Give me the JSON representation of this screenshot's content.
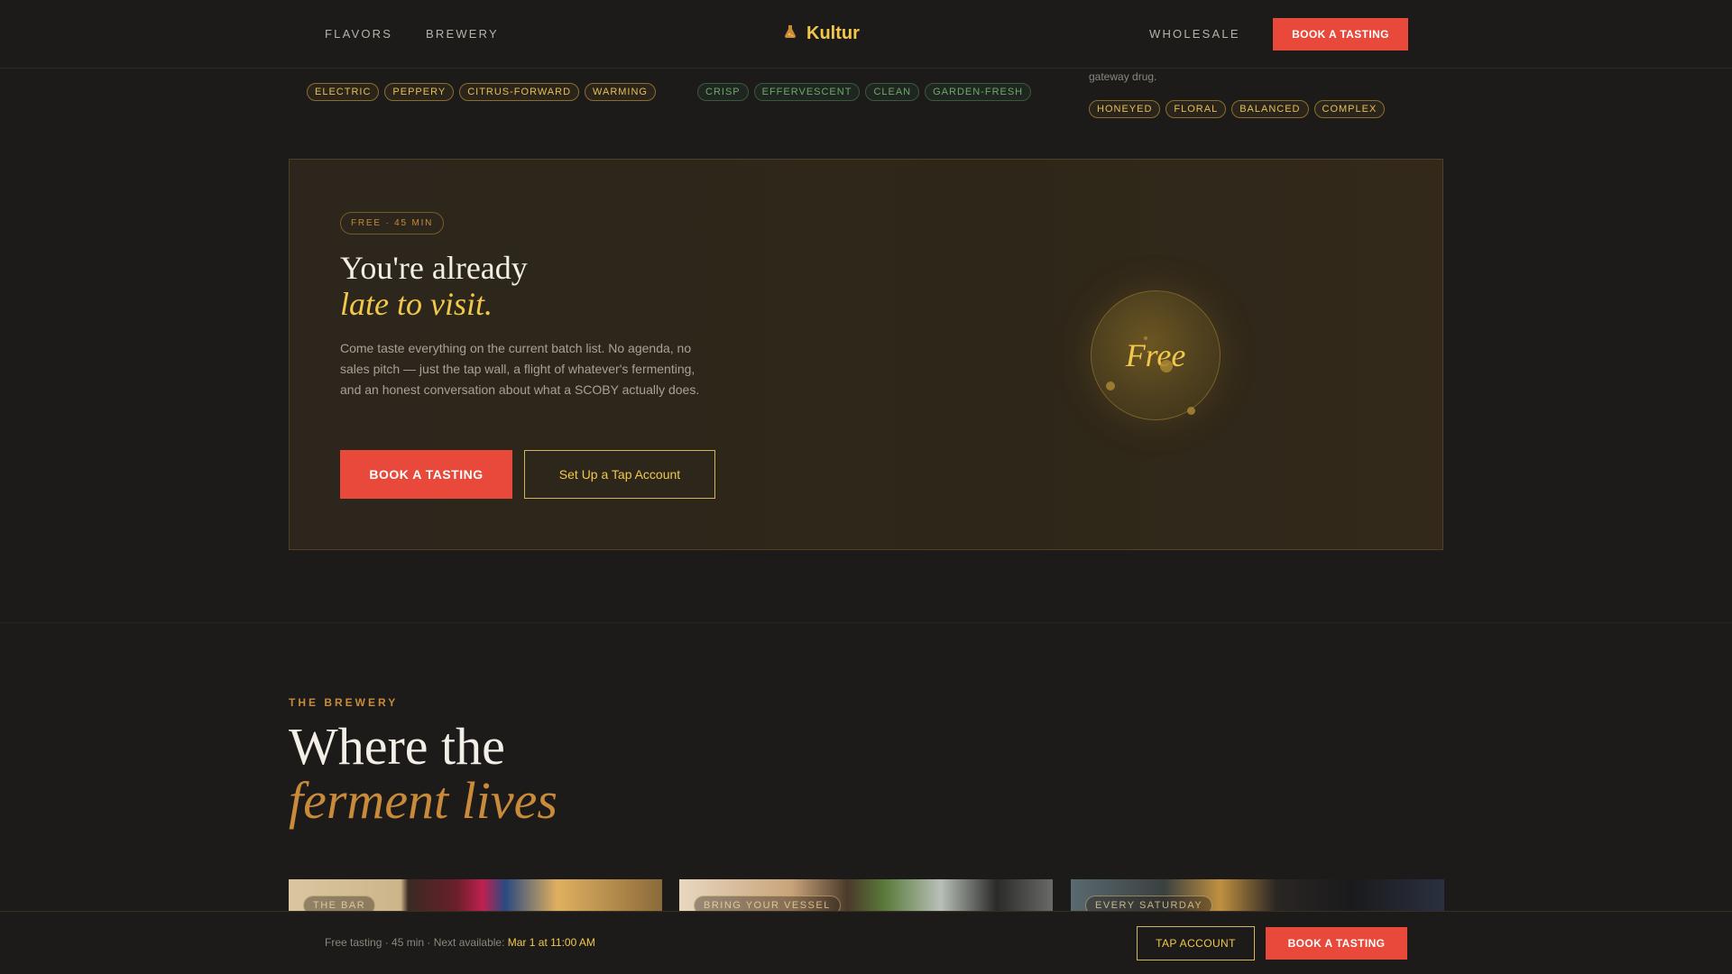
{
  "header": {
    "nav_left": [
      "FLAVORS",
      "BREWERY"
    ],
    "brand_name": "Kultur",
    "brand_icon": "flask-icon",
    "nav_right": "WHOLESALE",
    "cta": "BOOK A TASTING"
  },
  "flavor_tags": {
    "col1": [
      "ELECTRIC",
      "PEPPERY",
      "CITRUS-FORWARD",
      "WARMING"
    ],
    "col2": [
      "CRISP",
      "EFFERVESCENT",
      "CLEAN",
      "GARDEN-FRESH"
    ],
    "col3_tail_text": "gateway drug.",
    "col3": [
      "HONEYED",
      "FLORAL",
      "BALANCED",
      "COMPLEX"
    ]
  },
  "cta_card": {
    "pill": "FREE · 45 MIN",
    "title_line1": "You're already",
    "title_line2": "late to visit.",
    "body": "Come taste everything on the current batch list. No agenda, no sales pitch — just the tap wall, a flight of whatever's fermenting, and an honest conversation about what a SCOBY actually does.",
    "primary_button": "BOOK A TASTING",
    "secondary_button": "Set Up a Tap Account",
    "orb_text": "Free"
  },
  "brewery": {
    "eyebrow": "THE BREWERY",
    "title_line1": "Where the",
    "title_line2": "ferment lives",
    "photos": [
      {
        "label": "THE BAR"
      },
      {
        "label": "BRING YOUR VESSEL"
      },
      {
        "label": "EVERY SATURDAY"
      }
    ]
  },
  "footer_bar": {
    "text_prefix": "Free tasting · 45 min · Next available: ",
    "next_available": "Mar 1 at 11:00 AM",
    "tap_account": "TAP ACCOUNT",
    "book": "BOOK A TASTING"
  },
  "colors": {
    "accent_red": "#e8493a",
    "accent_gold": "#f2c84b",
    "accent_amber": "#c98a3a",
    "background": "#1c1b1a"
  }
}
